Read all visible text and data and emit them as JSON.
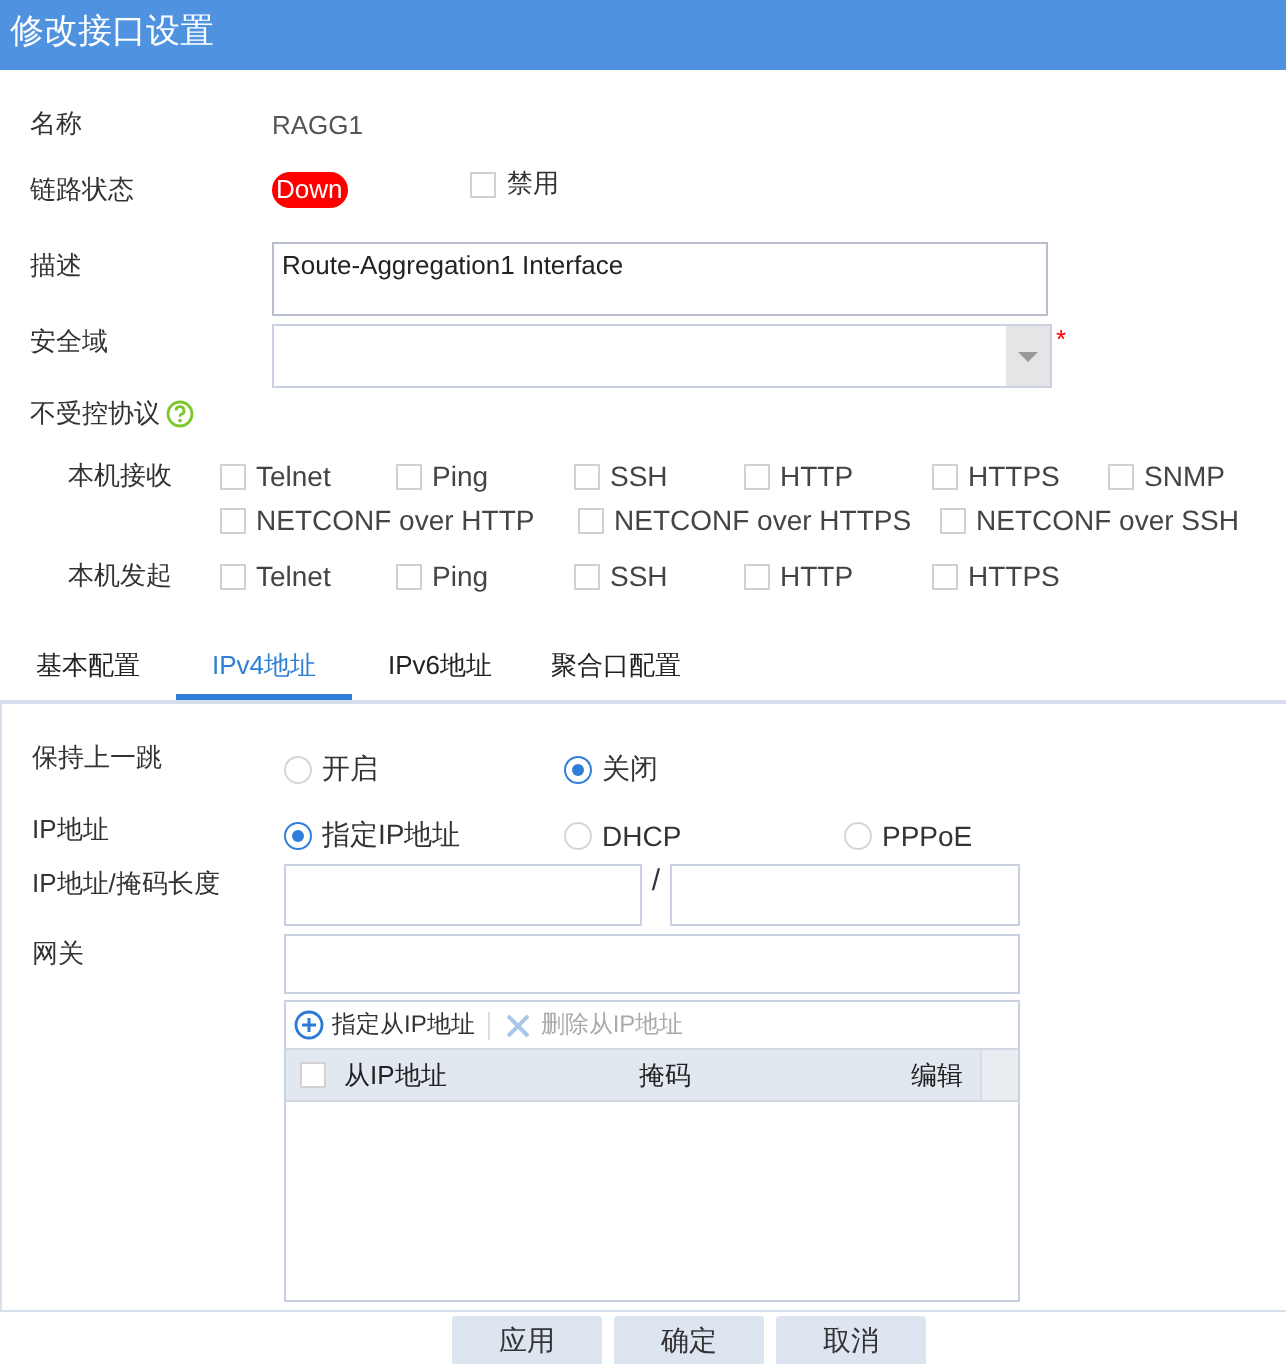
{
  "window": {
    "title": "修改接口设置"
  },
  "fields": [
    {
      "kind": "text",
      "label": "名称",
      "value": "RAGG1"
    },
    {
      "kind": "status",
      "label": "链路状态",
      "status": "Down",
      "disable": {
        "label": "禁用",
        "checked": false
      }
    },
    {
      "kind": "textarea",
      "label": "描述",
      "value": "Route-Aggregation1 Interface"
    },
    {
      "kind": "select",
      "label": "安全域",
      "required_mark": "*"
    }
  ],
  "protocols": {
    "label": "不受控协议",
    "groups": [
      {
        "label": "本机接收",
        "lines": [
          [
            {
              "label": "Telnet",
              "checked": false
            },
            {
              "label": "Ping",
              "checked": false
            },
            {
              "label": "SSH",
              "checked": false
            },
            {
              "label": "HTTP",
              "checked": false
            },
            {
              "label": "HTTPS",
              "checked": false
            },
            {
              "label": "SNMP",
              "checked": false
            }
          ],
          [
            {
              "label": "NETCONF over HTTP",
              "checked": false
            },
            {
              "label": "NETCONF over HTTPS",
              "checked": false
            },
            {
              "label": "NETCONF over SSH",
              "checked": false
            }
          ]
        ]
      },
      {
        "label": "本机发起",
        "lines": [
          [
            {
              "label": "Telnet",
              "checked": false
            },
            {
              "label": "Ping",
              "checked": false
            },
            {
              "label": "SSH",
              "checked": false
            },
            {
              "label": "HTTP",
              "checked": false
            },
            {
              "label": "HTTPS",
              "checked": false
            }
          ]
        ]
      }
    ]
  },
  "tabs": [
    {
      "label": "基本配置",
      "selected": false
    },
    {
      "label": "IPv4地址",
      "selected": true
    },
    {
      "label": "IPv6地址",
      "selected": false
    },
    {
      "label": "聚合口配置",
      "selected": false
    }
  ],
  "ipv4": {
    "keep_hop": {
      "label": "保持上一跳",
      "options": [
        {
          "label": "开启",
          "selected": false
        },
        {
          "label": "关闭",
          "selected": true
        }
      ]
    },
    "ip_mode": {
      "label": "IP地址",
      "options": [
        {
          "label": "指定IP地址",
          "selected": true
        },
        {
          "label": "DHCP",
          "selected": false
        },
        {
          "label": "PPPoE",
          "selected": false
        }
      ]
    },
    "ip_mask": {
      "label": "IP地址/掩码长度",
      "separator": "/"
    },
    "gateway": {
      "label": "网关"
    },
    "secondary": {
      "add": "指定从IP地址",
      "remove": "删除从IP地址",
      "remove_disabled": true,
      "select_all_checked": false,
      "columns": [
        "从IP地址",
        "掩码",
        "编辑"
      ]
    }
  },
  "buttons": [
    "应用",
    "确定",
    "取消"
  ]
}
